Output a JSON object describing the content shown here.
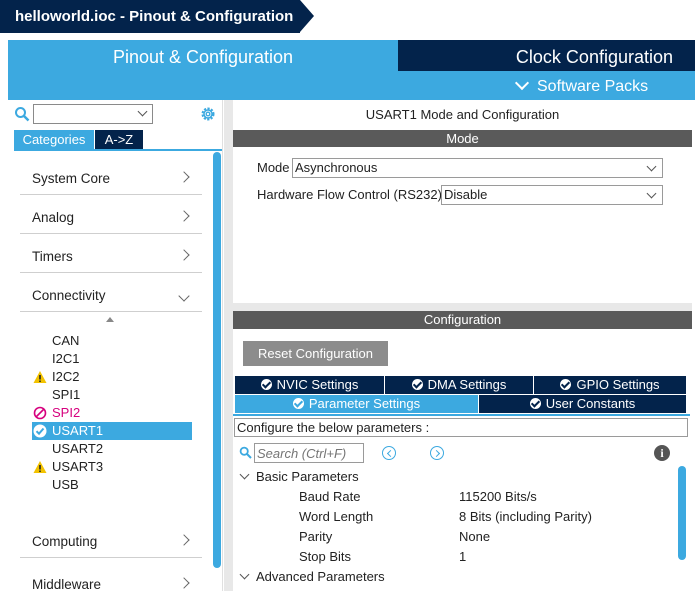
{
  "window": {
    "title": "helloworld.ioc - Pinout & Configuration"
  },
  "top_tabs": {
    "pinout": "Pinout & Configuration",
    "clock": "Clock Configuration",
    "software_packs": "Software Packs"
  },
  "left": {
    "tabs": {
      "categories": "Categories",
      "az": "A->Z"
    },
    "categories": [
      {
        "label": "System Core"
      },
      {
        "label": "Analog"
      },
      {
        "label": "Timers"
      },
      {
        "label": "Connectivity"
      },
      {
        "label": "Computing"
      },
      {
        "label": "Middleware"
      }
    ],
    "peripherals": [
      {
        "label": "CAN",
        "status": "none"
      },
      {
        "label": "I2C1",
        "status": "none"
      },
      {
        "label": "I2C2",
        "status": "warning"
      },
      {
        "label": "SPI1",
        "status": "none"
      },
      {
        "label": "SPI2",
        "status": "disabled"
      },
      {
        "label": "USART1",
        "status": "ok"
      },
      {
        "label": "USART2",
        "status": "none"
      },
      {
        "label": "USART3",
        "status": "warning"
      },
      {
        "label": "USB",
        "status": "none"
      }
    ]
  },
  "mode": {
    "title": "USART1 Mode and Configuration",
    "header": "Mode",
    "mode_label": "Mode",
    "mode_value": "Asynchronous",
    "flow_label": "Hardware Flow Control (RS232)",
    "flow_value": "Disable"
  },
  "config": {
    "header": "Configuration",
    "reset_label": "Reset Configuration",
    "tabs": [
      "NVIC Settings",
      "DMA Settings",
      "GPIO Settings",
      "Parameter Settings",
      "User Constants"
    ],
    "description": "Configure the below parameters :",
    "search_placeholder": "Search (Ctrl+F)",
    "groups": {
      "basic": "Basic Parameters",
      "advanced": "Advanced Parameters"
    },
    "params": [
      {
        "name": "Baud Rate",
        "value": "115200 Bits/s"
      },
      {
        "name": "Word Length",
        "value": "8 Bits (including Parity)"
      },
      {
        "name": "Parity",
        "value": "None"
      },
      {
        "name": "Stop Bits",
        "value": "1"
      }
    ]
  },
  "colors": {
    "navy": "#03234b",
    "accent": "#3ca9e0",
    "warning": "#f2c200",
    "disabled": "#d6007e",
    "ok": "#ffffff"
  }
}
